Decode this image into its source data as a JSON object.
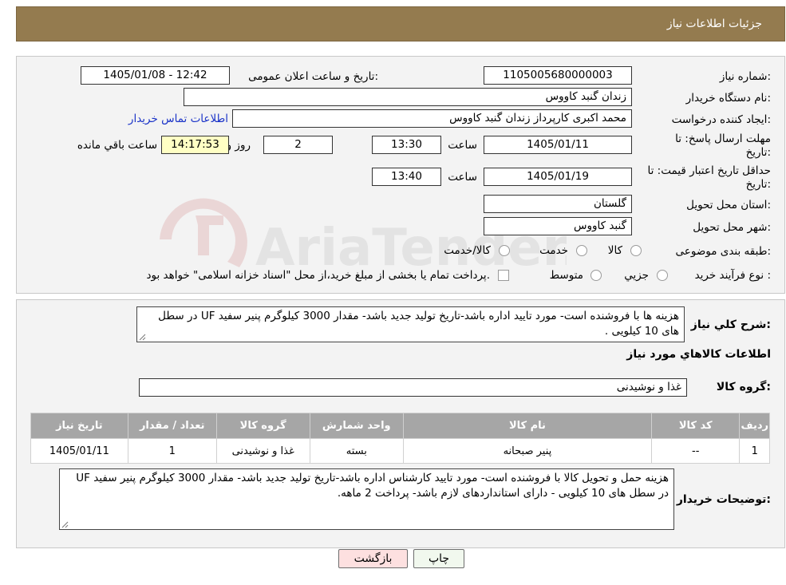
{
  "header": {
    "title": "جزئیات اطلاعات نیاز"
  },
  "form": {
    "need_number": {
      "label": "شماره نیاز:",
      "value": "1105005680000003"
    },
    "announce": {
      "label": "تاریخ و ساعت اعلان عمومی:",
      "value": "1405/01/08 - 12:42"
    },
    "buyer_org": {
      "label": "نام دستگاه خریدار:",
      "value": "زندان گنبد کاووس"
    },
    "requester": {
      "label": "ایجاد کننده درخواست:",
      "value": "محمد اکبری کارپرداز زندان گنبد کاووس",
      "contact_link": "اطلاعات تماس خریدار"
    },
    "deadline": {
      "label_line1": "مهلت ارسال پاسخ: تا",
      "label_line2": "تاریخ:",
      "date": "1405/01/11",
      "time_label": "ساعت",
      "time": "13:30",
      "days": "2",
      "days_label": "روز و",
      "remaining": "14:17:53",
      "remaining_label": "ساعت باقي مانده"
    },
    "price_validity": {
      "label_line1": "حداقل تاریخ اعتبار قیمت: تا",
      "label_line2": "تاریخ:",
      "date": "1405/01/19",
      "time_label": "ساعت",
      "time": "13:40"
    },
    "province": {
      "label": "استان محل تحویل:",
      "value": "گلستان"
    },
    "city": {
      "label": "شهر محل تحویل:",
      "value": "گنبد کاووس"
    },
    "category": {
      "label": "طبقه بندی موضوعی:",
      "options": [
        "کالا",
        "خدمت",
        "کالا/خدمت"
      ]
    },
    "purchase_type": {
      "label": "نوع فرآیند خرید :",
      "options": [
        "جزیي",
        "متوسط"
      ],
      "note": "پرداخت تمام یا بخشی از مبلغ خرید،از محل \"اسناد خزانه اسلامی\" خواهد بود."
    }
  },
  "description": {
    "label": "شرح کلي نياز:",
    "text": "هزینه ها با فروشنده است- مورد تایید اداره باشد-تاریخ تولید جدید باشد- مقدار 3000 کیلوگرم پنیر سفید UF در سطل های 10 کیلویی ."
  },
  "goods_section": {
    "title": "اطلاعات کالاهاي مورد نياز",
    "group_label": "گروه کالا:",
    "group_value": "غذا و نوشیدنی"
  },
  "table": {
    "headers": [
      "ردیف",
      "کد کالا",
      "نام کالا",
      "واحد شمارش",
      "گروه کالا",
      "تعداد / مقدار",
      "تاریخ نیاز"
    ],
    "rows": [
      [
        "1",
        "--",
        "پنیر صبحانه",
        "بسته",
        "غذا و نوشیدنی",
        "1",
        "1405/01/11"
      ]
    ]
  },
  "buyer_notes": {
    "label": "توضیحات خریدار:",
    "text": "هزینه حمل و تحویل کالا با فروشنده است- مورد تایید کارشناس اداره باشد-تاریخ تولید جدید باشد- مقدار 3000 کیلوگرم پنیر سفید UF در سطل های 10 کیلویی - دارای استانداردهای لازم باشد- پرداخت 2 ماهه."
  },
  "buttons": {
    "print": "چاپ",
    "back": "بازگشت"
  },
  "watermark": {
    "text": "AriaTender.neT"
  },
  "colors": {
    "header_bg": "#947b4f",
    "table_header_bg": "#a6a6a6",
    "back_button_bg": "#fde0e0",
    "remaining_bg": "#ffffc4",
    "link": "#1a33c8"
  }
}
